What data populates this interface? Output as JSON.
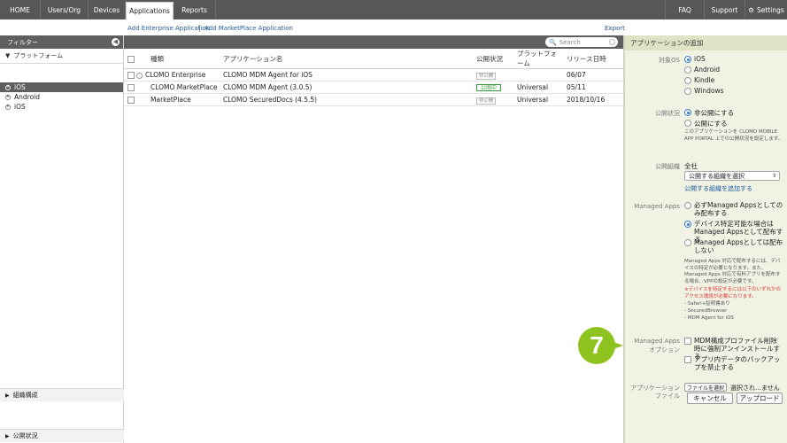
{
  "nav": {
    "items": [
      "HOME",
      "Users/Org",
      "Devices",
      "Applications",
      "Reports"
    ],
    "right_items": [
      "FAQ",
      "Support",
      "Settings"
    ]
  },
  "subbar": {
    "add_enterprise": "Add Enterprise Application",
    "separator": "|",
    "add_marketplace": "Add MarketPlace Application",
    "export": "Export"
  },
  "sidebar": {
    "filter_title": "フィルター",
    "platform_section": "プラットフォーム",
    "tree": [
      {
        "label": "iOS"
      },
      {
        "label": "Android"
      },
      {
        "label": "iOS"
      }
    ],
    "bottom": [
      "組織構成",
      "公開状況"
    ]
  },
  "table": {
    "search_placeholder": "Search",
    "headers": [
      "種類",
      "アプリケーション名",
      "公開状況",
      "プラットフォーム",
      "リリース日時"
    ],
    "rows": [
      {
        "type": "CLOMO Enterprise",
        "name": "CLOMO MDM Agent for iOS",
        "status": "非公開",
        "platform": "",
        "date": "06/07"
      },
      {
        "type": "CLOMO MarketPlace",
        "name": "CLOMO MDM Agent (3.0.5)",
        "status": "公開中",
        "platform": "Universal",
        "date": "05/11"
      },
      {
        "type": "MarketPlace",
        "name": "CLOMO SecuredDocs (4.5.5)",
        "status": "非公開",
        "platform": "Universal",
        "date": "2018/10/16"
      }
    ]
  },
  "panel": {
    "title": "アプリケーションの追加",
    "target_os_label": "対象OS",
    "os_options": [
      "iOS",
      "Android",
      "Kindle",
      "Windows"
    ],
    "publish_label": "公開状況",
    "publish_options": [
      "非公開にする",
      "公開にする"
    ],
    "publish_note": "このアプリケーションを CLOMO MOBILE APP PORTAL 上での公開状況を設定します。",
    "org_label": "公開組織",
    "org_value": "全社",
    "org_select": "公開する組織を選択",
    "org_add_link": "公開する組織を追加する",
    "managed_label": "Managed Apps",
    "managed_options": [
      "必ずManaged Appsとしてのみ配布する",
      "デバイス特定可能な場合はManaged Appsとして配布する",
      "Managed Appsとしては配布しない"
    ],
    "managed_note": "Managed Apps 対応で配布するには、デバイスの特定が必要となります。また、Managed Apps 対応で有料アプリを配布する場合、VPPの設定が必要です。",
    "managed_warn": "※デバイスを特定するには以下のいずれかのアクセス環境が必要になります。",
    "managed_list": [
      "- Safari+証明書あり",
      "- SecuredBrowser",
      "- MDM Agent for iOS"
    ],
    "option_label_1": "Managed Apps",
    "option_label_2": "オプション",
    "option_checks": [
      "MDM構成プロファイル削除時に強制アンインストールする",
      "アプリ内データのバックアップを禁止する"
    ],
    "file_label_1": "アプリケーション",
    "file_label_2": "ファイル",
    "file_button": "ファイルを選択",
    "file_status": "選択され…ません",
    "cancel": "キャンセル",
    "upload": "アップロード"
  },
  "callout": "7"
}
